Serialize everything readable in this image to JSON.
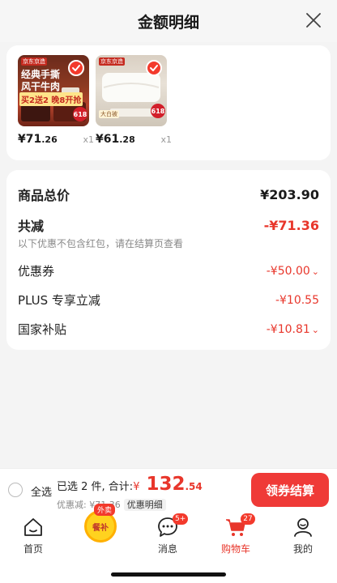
{
  "header": {
    "title": "金额明细"
  },
  "products": [
    {
      "thumb_lines": [
        "经典手撕",
        "风干牛肉",
        "买2送2 晚8开抢"
      ],
      "brand_tag": "京东京造",
      "badge": "618",
      "price_int": "¥71",
      "price_cents": ".26",
      "qty": "x1"
    },
    {
      "thumb_lines": [
        "大白被"
      ],
      "brand_tag": "京东京造",
      "badge": "618",
      "price_int": "¥61",
      "price_cents": ".28",
      "qty": "x1"
    }
  ],
  "detail": {
    "total_label": "商品总价",
    "total_value": "¥203.90",
    "discount_label": "共减",
    "discount_value": "-¥71.36",
    "discount_note": "以下优惠不包含红包，请在结算页查看",
    "items": [
      {
        "label": "优惠券",
        "value": "-¥50.00",
        "chevron": "⌄"
      },
      {
        "label": "PLUS 专享立减",
        "value": "-¥10.55",
        "chevron": ""
      },
      {
        "label": "国家补贴",
        "value": "-¥10.81",
        "chevron": "⌄"
      }
    ]
  },
  "bottom": {
    "select_all": "全选",
    "selected_text": "已选 2 件, 合计:",
    "yen": "¥",
    "total_int": " 132",
    "total_cents": ".54",
    "discount_text": "优惠减: ¥71.36",
    "detail_link": "优惠明细",
    "checkout": "领券结算"
  },
  "tabs": [
    {
      "label": "首页",
      "icon": "home-icon"
    },
    {
      "label": "消息",
      "icon": "message-icon",
      "badge": "5+"
    },
    {
      "label": "购物车",
      "icon": "cart-icon",
      "badge": "27",
      "active": true
    },
    {
      "label": "我的",
      "icon": "profile-icon"
    }
  ],
  "promo": {
    "tag": "外卖",
    "text": "餐补"
  },
  "colors": {
    "accent": "#e8362b",
    "button": "#ef3a37"
  }
}
